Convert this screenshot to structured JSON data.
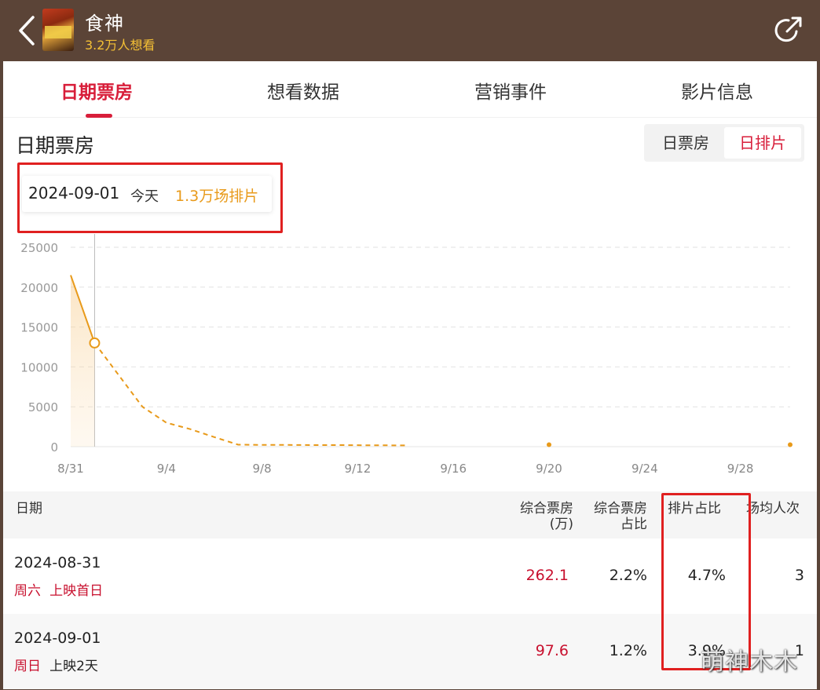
{
  "header": {
    "title": "食神",
    "want_count": "3.2万人想看",
    "icons": {
      "back": "chevron-left-icon",
      "share": "share-icon"
    }
  },
  "tabs": [
    {
      "label": "日期票房",
      "active": true
    },
    {
      "label": "想看数据",
      "active": false
    },
    {
      "label": "营销事件",
      "active": false
    },
    {
      "label": "影片信息",
      "active": false
    }
  ],
  "section": {
    "title": "日期票房",
    "toggle": [
      {
        "label": "日票房",
        "active": false
      },
      {
        "label": "日排片",
        "active": true
      }
    ]
  },
  "tooltip": {
    "date": "2024-09-01",
    "today": "今天",
    "value": "1.3万场排片"
  },
  "colors": {
    "accent": "#d81e3a",
    "line": "#e89a1a",
    "header_bg": "#5b4437",
    "want": "#f4c035",
    "highlight": "#e02020"
  },
  "chart_data": {
    "type": "line",
    "x_tick_labels": [
      "8/31",
      "9/4",
      "9/8",
      "9/12",
      "9/16",
      "9/20",
      "9/24",
      "9/28"
    ],
    "y_tick_labels": [
      "25000",
      "20000",
      "15000",
      "10000",
      "5000",
      "0"
    ],
    "ylim": [
      0,
      25000
    ],
    "grid": true,
    "actual": {
      "x": [
        "8/31",
        "9/1"
      ],
      "y": [
        21500,
        13000
      ]
    },
    "forecast": {
      "x": [
        "9/1",
        "9/2",
        "9/3",
        "9/4",
        "9/5",
        "9/6",
        "9/7",
        "9/8",
        "9/9",
        "9/10",
        "9/11",
        "9/12",
        "9/13",
        "9/14"
      ],
      "y": [
        13000,
        9000,
        5000,
        3000,
        2200,
        1200,
        250,
        220,
        220,
        200,
        200,
        180,
        170,
        160
      ]
    },
    "markers": [
      {
        "x": "9/20",
        "y": 150
      },
      {
        "x": "10/1",
        "y": 150
      }
    ],
    "selected_x": "9/1"
  },
  "table": {
    "headers": {
      "date": "日期",
      "box_office_1": "综合票房",
      "box_office_2": "(万)",
      "share_1": "综合票房",
      "share_2": "占比",
      "screening": "排片占比",
      "avg_1": "场均人次"
    },
    "rows": [
      {
        "date": "2024-08-31",
        "weekday": "周六",
        "note": "上映首日",
        "box_office": "262.1",
        "share": "2.2%",
        "screening": "4.7%",
        "avg": "3"
      },
      {
        "date": "2024-09-01",
        "weekday": "周日",
        "note": "上映2天",
        "box_office": "97.6",
        "share": "1.2%",
        "screening": "3.9%",
        "avg": "1"
      }
    ]
  },
  "watermark": "萌神木木"
}
